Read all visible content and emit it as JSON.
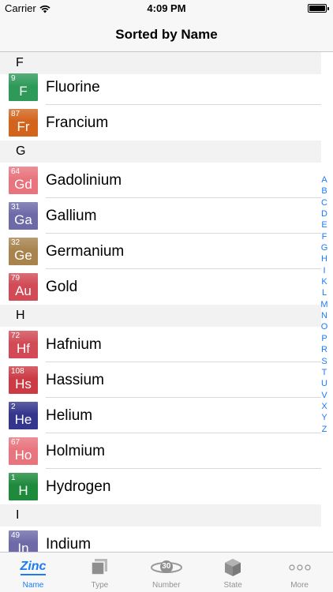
{
  "status": {
    "carrier": "Carrier",
    "time": "4:09 PM"
  },
  "nav": {
    "title": "Sorted by Name"
  },
  "colors": {
    "accent": "#1a7cf5",
    "tab_inactive": "#929292"
  },
  "list": [
    {
      "kind": "row",
      "number": "9",
      "symbol": "F",
      "name": "Fluorine",
      "color": "#2e9a5a",
      "partial": true
    },
    {
      "kind": "row",
      "number": "87",
      "symbol": "Fr",
      "name": "Francium",
      "color": "#d2641c"
    },
    {
      "kind": "section",
      "title": "G"
    },
    {
      "kind": "row",
      "number": "64",
      "symbol": "Gd",
      "name": "Gadolinium",
      "color": "#e8747e"
    },
    {
      "kind": "row",
      "number": "31",
      "symbol": "Ga",
      "name": "Gallium",
      "color": "#6e6aa8"
    },
    {
      "kind": "row",
      "number": "32",
      "symbol": "Ge",
      "name": "Germanium",
      "color": "#a8834e"
    },
    {
      "kind": "row",
      "number": "79",
      "symbol": "Au",
      "name": "Gold",
      "color": "#d14a55"
    },
    {
      "kind": "section",
      "title": "H"
    },
    {
      "kind": "row",
      "number": "72",
      "symbol": "Hf",
      "name": "Hafnium",
      "color": "#d14a55"
    },
    {
      "kind": "row",
      "number": "108",
      "symbol": "Hs",
      "name": "Hassium",
      "color": "#cc3a44"
    },
    {
      "kind": "row",
      "number": "2",
      "symbol": "He",
      "name": "Helium",
      "color": "#34358c"
    },
    {
      "kind": "row",
      "number": "67",
      "symbol": "Ho",
      "name": "Holmium",
      "color": "#e8747e"
    },
    {
      "kind": "row",
      "number": "1",
      "symbol": "H",
      "name": "Hydrogen",
      "color": "#1d8a3c"
    },
    {
      "kind": "section",
      "title": "I"
    },
    {
      "kind": "row",
      "number": "49",
      "symbol": "In",
      "name": "Indium",
      "color": "#6e6aa8"
    }
  ],
  "top_section": "F",
  "index_letters": [
    "A",
    "B",
    "C",
    "D",
    "E",
    "F",
    "G",
    "H",
    "I",
    "K",
    "L",
    "M",
    "N",
    "O",
    "P",
    "R",
    "S",
    "T",
    "U",
    "V",
    "X",
    "Y",
    "Z"
  ],
  "tabs": [
    {
      "label": "Name",
      "icon": "zinc-text-icon",
      "icon_text": "Zinc",
      "active": true
    },
    {
      "label": "Type",
      "icon": "stacked-squares-icon"
    },
    {
      "label": "Number",
      "icon": "orbit-number-icon",
      "icon_text": "30"
    },
    {
      "label": "State",
      "icon": "cube-icon"
    },
    {
      "label": "More",
      "icon": "more-dots-icon"
    }
  ]
}
